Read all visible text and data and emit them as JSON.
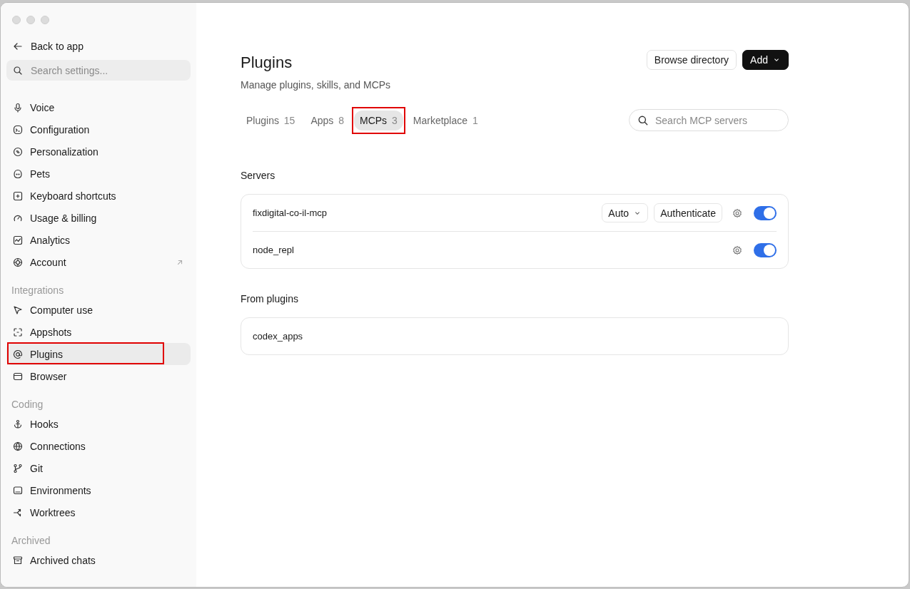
{
  "sidebar": {
    "back": "Back to app",
    "search": {
      "placeholder": "Search settings..."
    },
    "groups": [
      {
        "items": [
          {
            "label": "Voice",
            "selected": false
          },
          {
            "label": "Configuration",
            "selected": false
          },
          {
            "label": "Personalization",
            "selected": false
          },
          {
            "label": "Pets",
            "selected": false
          },
          {
            "label": "Keyboard shortcuts",
            "selected": false
          },
          {
            "label": "Usage & billing",
            "selected": false
          },
          {
            "label": "Analytics",
            "selected": false
          },
          {
            "label": "Account",
            "selected": false,
            "external": true
          }
        ]
      },
      {
        "heading": "Integrations",
        "items": [
          {
            "label": "Computer use",
            "selected": false
          },
          {
            "label": "Appshots",
            "selected": false
          },
          {
            "label": "Plugins",
            "selected": true,
            "annotated": true
          },
          {
            "label": "Browser",
            "selected": false
          }
        ]
      },
      {
        "heading": "Coding",
        "items": [
          {
            "label": "Hooks",
            "selected": false
          },
          {
            "label": "Connections",
            "selected": false
          },
          {
            "label": "Git",
            "selected": false
          },
          {
            "label": "Environments",
            "selected": false
          },
          {
            "label": "Worktrees",
            "selected": false
          }
        ]
      },
      {
        "heading": "Archived",
        "items": [
          {
            "label": "Archived chats",
            "selected": false
          }
        ]
      }
    ]
  },
  "page": {
    "title": "Plugins",
    "subtitle": "Manage plugins, skills, and MCPs",
    "buttons": [
      {
        "label": "Browse directory",
        "kind": "outline"
      },
      {
        "label": "Add",
        "kind": "dark"
      }
    ],
    "tabs": [
      {
        "label": "Plugins",
        "count": "15",
        "selected": false
      },
      {
        "label": "Apps",
        "count": "8",
        "selected": false
      },
      {
        "label": "MCPs",
        "count": "3",
        "selected": true,
        "annotated": true
      },
      {
        "label": "Marketplace",
        "count": "1",
        "selected": false
      }
    ],
    "search": {
      "placeholder": "Search MCP servers"
    },
    "sections": [
      {
        "title": "Servers",
        "rows": [
          {
            "name": "fixdigital-co-il-mcp",
            "mode": "Auto",
            "action": "Authenticate",
            "on": true
          },
          {
            "name": "node_repl",
            "on": true
          }
        ]
      },
      {
        "title": "From plugins",
        "rows": [
          {
            "name": "codex_apps"
          }
        ]
      }
    ]
  }
}
